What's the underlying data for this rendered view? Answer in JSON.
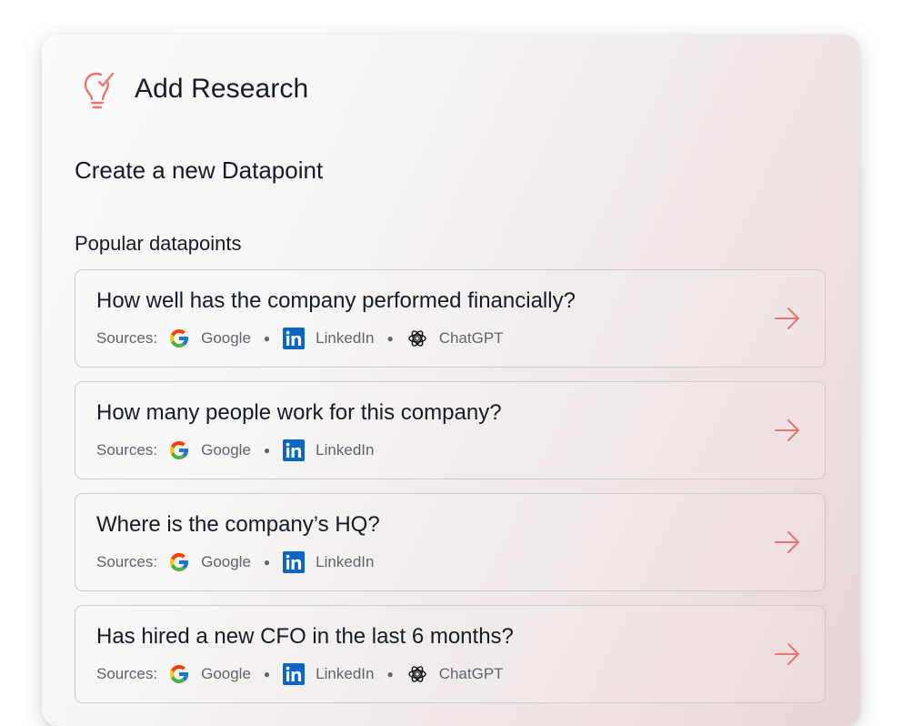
{
  "header": {
    "title": "Add Research",
    "icon": "lightbulb-check-icon"
  },
  "subtitle": "Create a new Datapoint",
  "section_label": "Popular datapoints",
  "colors": {
    "accent": "#e8766f",
    "linkedin": "#0a66c2"
  },
  "sources_label": "Sources:",
  "source_names": {
    "google": "Google",
    "linkedin": "LinkedIn",
    "chatgpt": "ChatGPT"
  },
  "datapoints": [
    {
      "question": "How well has the company performed financially?",
      "sources": [
        "Google",
        "LinkedIn",
        "ChatGPT"
      ]
    },
    {
      "question": "How many people work for this company?",
      "sources": [
        "Google",
        "LinkedIn"
      ]
    },
    {
      "question": "Where is the company’s HQ?",
      "sources": [
        "Google",
        "LinkedIn"
      ]
    },
    {
      "question": "Has hired a new CFO in the last 6 months?",
      "sources": [
        "Google",
        "LinkedIn",
        "ChatGPT"
      ]
    }
  ]
}
